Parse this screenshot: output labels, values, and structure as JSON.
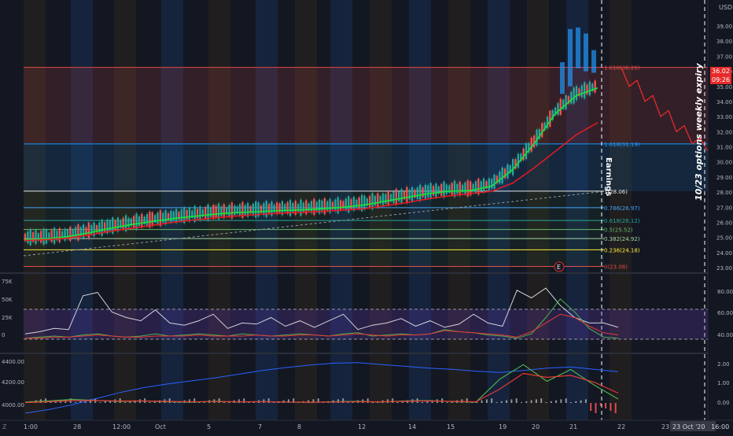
{
  "header": {
    "currency": "USD"
  },
  "price_badges": {
    "last_price": "36.02",
    "countdown": "09:26",
    "marker_letter": "E"
  },
  "annotations": {
    "earnings": "Earnings",
    "expiry": "10/23 options weekly expiry"
  },
  "colors": {
    "background": "#131722",
    "fast_ma": "#19e63a",
    "slow_ma": "#e01a24",
    "price_line": "#e62a2a",
    "fib_blue": "#2196f3",
    "grid_text": "#b2b5be"
  },
  "chart_data": [
    {
      "type": "candlestick",
      "pane": "price",
      "ylim": [
        22.7,
        39.7
      ],
      "y_ticks": [
        "23.00",
        "24.00",
        "25.00",
        "26.00",
        "27.00",
        "28.00",
        "29.00",
        "30.00",
        "31.00",
        "32.00",
        "33.00",
        "34.00",
        "35.00",
        "36.00",
        "37.00",
        "38.00",
        "39.00"
      ],
      "x_ticks": [
        "1:00",
        "28",
        "12:00",
        "Oct",
        "5",
        "7",
        "8",
        "12",
        "14",
        "15",
        "19",
        "20",
        "21",
        "22",
        "23"
      ],
      "fib_levels": [
        {
          "label": "1.618(36.26)",
          "value": 36.26,
          "color": "#e04848"
        },
        {
          "label": "1.618(31.19)",
          "value": 31.19,
          "color": "#2196f3"
        },
        {
          "label": "1(28.06)",
          "value": 28.06,
          "color": "#e6e6e6"
        },
        {
          "label": "0.786(26.97)",
          "value": 26.97,
          "color": "#42a5f5"
        },
        {
          "label": "0.618(26.12)",
          "value": 26.12,
          "color": "#26a69a"
        },
        {
          "label": "0.5(25.52)",
          "value": 25.52,
          "color": "#66bb6a"
        },
        {
          "label": "0.382(24.92)",
          "value": 24.92,
          "color": "#a5d6a7"
        },
        {
          "label": "0.236(24.18)",
          "value": 24.18,
          "color": "#ffeb3b"
        },
        {
          "label": "0(23.08)",
          "value": 23.08,
          "color": "#e04848"
        }
      ],
      "series": [
        {
          "name": "",
          "color": "#19e63a",
          "values": [
            24.85,
            24.9,
            25.05,
            25.3,
            25.6,
            25.85,
            26.05,
            26.25,
            26.4,
            26.55,
            26.65,
            26.7,
            26.78,
            26.82,
            26.9,
            27.0,
            27.15,
            27.4,
            27.65,
            27.9,
            28.05,
            28.1,
            28.4,
            29.5,
            31.2,
            33.2,
            34.4,
            34.9
          ]
        },
        {
          "name": "",
          "color": "#e01a24",
          "values": [
            24.8,
            24.85,
            24.95,
            25.15,
            25.4,
            25.6,
            25.8,
            26.0,
            26.15,
            26.3,
            26.42,
            26.52,
            26.6,
            26.66,
            26.72,
            26.8,
            26.9,
            27.1,
            27.3,
            27.55,
            27.75,
            27.9,
            28.05,
            28.6,
            29.6,
            30.7,
            31.8,
            32.6
          ]
        }
      ],
      "projection": [
        36.26,
        35.0,
        35.4,
        34.0,
        34.4,
        33.0,
        33.4,
        32.0,
        32.4,
        31.2,
        31.6,
        30.7
      ]
    },
    {
      "type": "line",
      "pane": "oscillator",
      "y_ticks_left": [
        "0",
        "25K",
        "50K",
        "75K"
      ],
      "y_ticks_right": [
        "40.00",
        "60.00",
        "80.00"
      ],
      "band": [
        40,
        62
      ],
      "series": [
        {
          "name": "",
          "color": "#d1d4dc",
          "values": [
            40,
            42,
            45,
            44,
            75,
            78,
            60,
            55,
            52,
            62,
            50,
            48,
            52,
            58,
            45,
            50,
            49,
            55,
            47,
            52,
            46,
            52,
            58,
            44,
            48,
            50,
            54,
            47,
            52,
            46,
            49,
            58,
            50,
            47,
            80,
            73,
            82,
            66,
            55,
            50,
            50,
            46
          ]
        },
        {
          "name": "",
          "color": "#4caf50",
          "values": [
            36,
            37,
            38,
            37,
            39,
            40,
            38,
            37,
            38,
            40,
            38,
            39,
            40,
            39,
            38,
            40,
            39,
            38,
            39,
            40,
            39,
            38,
            40,
            41,
            38,
            39,
            40,
            39,
            40,
            44,
            42,
            41,
            39,
            38,
            36,
            40,
            55,
            72,
            60,
            45,
            37,
            36
          ]
        },
        {
          "name": "",
          "color": "#e53935",
          "values": [
            36,
            36,
            37,
            37,
            38,
            39,
            38,
            37,
            37,
            38,
            38,
            38,
            39,
            38,
            38,
            38,
            39,
            38,
            38,
            39,
            39,
            38,
            39,
            40,
            39,
            38,
            39,
            39,
            40,
            43,
            42,
            41,
            40,
            39,
            37,
            42,
            50,
            58,
            55,
            47,
            41,
            39
          ]
        }
      ]
    },
    {
      "type": "line",
      "pane": "macd",
      "y_ticks_left": [
        "4000.00",
        "4200.00",
        "4400.00"
      ],
      "y_ticks_right": [
        "0.00",
        "1.00",
        "2.00"
      ],
      "series": [
        {
          "name": "",
          "color": "#2962ff",
          "values": [
            3960,
            3990,
            4030,
            4080,
            4130,
            4170,
            4200,
            4225,
            4250,
            4280,
            4310,
            4335,
            4355,
            4370,
            4375,
            4360,
            4345,
            4330,
            4320,
            4305,
            4295,
            4310,
            4330,
            4340,
            4320,
            4300
          ]
        },
        {
          "name": "",
          "color": "#4caf50",
          "values": [
            0.05,
            0.1,
            0.18,
            0.12,
            0.08,
            0.1,
            0.06,
            0.04,
            0.08,
            0.05,
            0.07,
            0.05,
            0.03,
            0.06,
            0.08,
            0.05,
            0.1,
            0.12,
            0.07,
            0.04,
            1.2,
            1.95,
            1.1,
            1.7,
            0.9,
            0.2
          ]
        },
        {
          "name": "",
          "color": "#e53935",
          "values": [
            0.02,
            0.06,
            0.12,
            0.12,
            0.1,
            0.1,
            0.08,
            0.06,
            0.07,
            0.06,
            0.06,
            0.05,
            0.04,
            0.05,
            0.06,
            0.06,
            0.08,
            0.1,
            0.08,
            0.06,
            0.7,
            1.5,
            1.3,
            1.4,
            1.05,
            0.5
          ]
        }
      ]
    }
  ]
}
